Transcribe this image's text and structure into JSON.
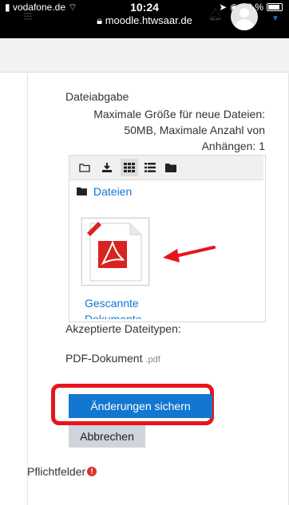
{
  "status_bar": {
    "carrier": "vodafone.de",
    "time": "10:24",
    "url": "moodle.htwsaar.de",
    "battery": "88 %"
  },
  "navbar": {
    "menu_icon": "hamburger-icon",
    "notification_icon": "bell-icon",
    "avatar_icon": "user-avatar",
    "caret_icon": "caret-down-icon"
  },
  "form": {
    "upload_label": "Dateiabgabe",
    "size_info": [
      "Maximale Größe für neue Dateien:",
      "50MB, Maximale Anzahl von",
      "Anhängen: 1"
    ],
    "breadcrumb": "Dateien",
    "file_name": "Gescannte",
    "file_name_cut": "Dokumente",
    "accepted_label": "Akzeptierte Dateitypen:",
    "accepted_type": "PDF-Dokument",
    "accepted_ext": ".pdf",
    "save_label": "Änderungen sichern",
    "cancel_label": "Abbrechen",
    "required_label": "Pflichtfelder"
  },
  "colors": {
    "accent": "#1177d1",
    "highlight": "#e8141d",
    "required": "#d9342b"
  }
}
